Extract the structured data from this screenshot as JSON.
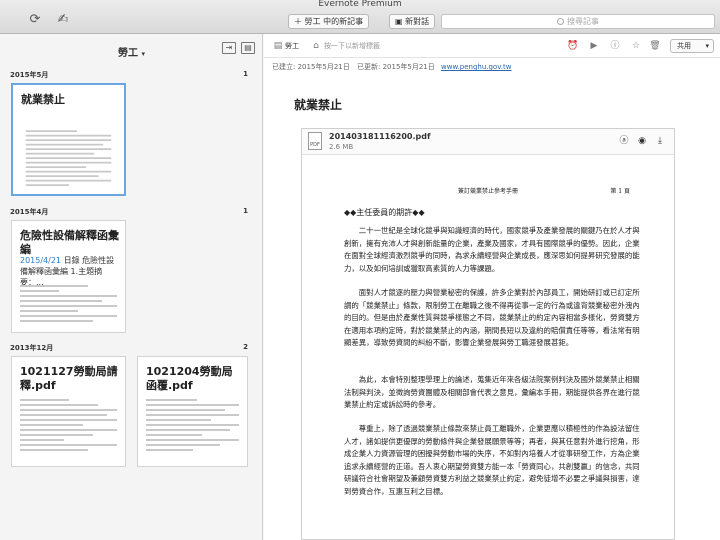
{
  "window": {
    "title": "Evernote Premium"
  },
  "toolbar": {
    "new_note_label": "勞工 中的新記事",
    "new_chat_label": "新對話",
    "search_placeholder": "搜尋記事"
  },
  "list": {
    "title": "勞工",
    "sections": [
      {
        "label": "2015年5月",
        "count": "1"
      },
      {
        "label": "2015年4月",
        "count": "1"
      },
      {
        "label": "2013年12月",
        "count": "2"
      }
    ],
    "cards": [
      {
        "title": "就業禁止"
      },
      {
        "title": "危險性設備解釋函彙編",
        "snippet_date": "2015/4/21",
        "snippet_rest": " 日錄 危險性設備解釋函彙編 1.主題摘要：..."
      },
      {
        "title": "1021127勞動局請釋.pdf"
      },
      {
        "title": "1021204勞動局函覆.pdf"
      }
    ]
  },
  "note": {
    "notebook_label": "勞工",
    "tag_hint": "按一下以新增標籤",
    "share_label": "共用",
    "created": "已建立: 2015年5月21日",
    "updated": "已更新: 2015年5月21日",
    "source_url": "www.penghu.gov.tw",
    "title": "就業禁止",
    "attachment": {
      "filename": "201403181116200.pdf",
      "size": "2.6 MB",
      "icon_label": "PDF",
      "page_header": "簽訂競業禁止參考手冊",
      "page_number": "第 1 頁",
      "section_heading": "◆◆主任委員的期許◆◆",
      "paragraphs": [
        "　　二十一世紀是全球化競爭與知識經濟的時代，國家競爭及產業發展的關鍵乃在於人才與創新，擁有充沛人才與創新能量的企業，產業及國家，才具有國際競爭的優勢。因此，企業在面對全球經濟激烈競爭的同時，為求永續經營與企業成長，應深思如何提昇研究發展的能力，以及如何培訓或獵取高素質的人力等課題。",
        "　　面對人才競逐的壓力與營業秘密的保護，許多企業對於內部員工，開始研訂或已訂定所謂的「競業禁止」條款，限制勞工在離職之後不得再從事一定的行為或違背競業秘密外洩內的目的。但是由於產業性質與競爭樣態之不同，競業禁止的約定內容相當多樣化，勞資雙方在適用本項約定時，對於競業禁止的內涵，期間長短以及違約的賠償責任等等，看法常有明顯差異，導致勞資間的糾紛不斷，影響企業發展與勞工職涯發展甚鉅。",
        "　　為此，本會特別整理學理上的論述，蒐集近年來各級法院案例判決及國外競業禁止相關法制與判決，並徵詢勞資團體及相關部會代表之意見，彙編本手冊，期能提供各界在進行競業禁止約定或訴訟時的參考。",
        "　　尊重上，除了透過競業禁止條款來禁止員工離職外，企業更應以積極性的作為設法留住人才，諸如提供更優厚的勞動條件與企業發展願景等等；再者，與其任意對外進行挖角，形成企業人力資源管理的困擾與勞動市場的失序，不如對內培養人才從事研發工作，方為企業追求永續經營的正道。吾人衷心期望勞資雙方能一本「勞資同心，共創雙贏」的信念，共同研議符合社會期望及兼顧勞資雙方利益之競業禁止約定，避免徒增不必要之爭議與損害，達到勞資合作，互惠互利之目標。"
      ]
    }
  }
}
